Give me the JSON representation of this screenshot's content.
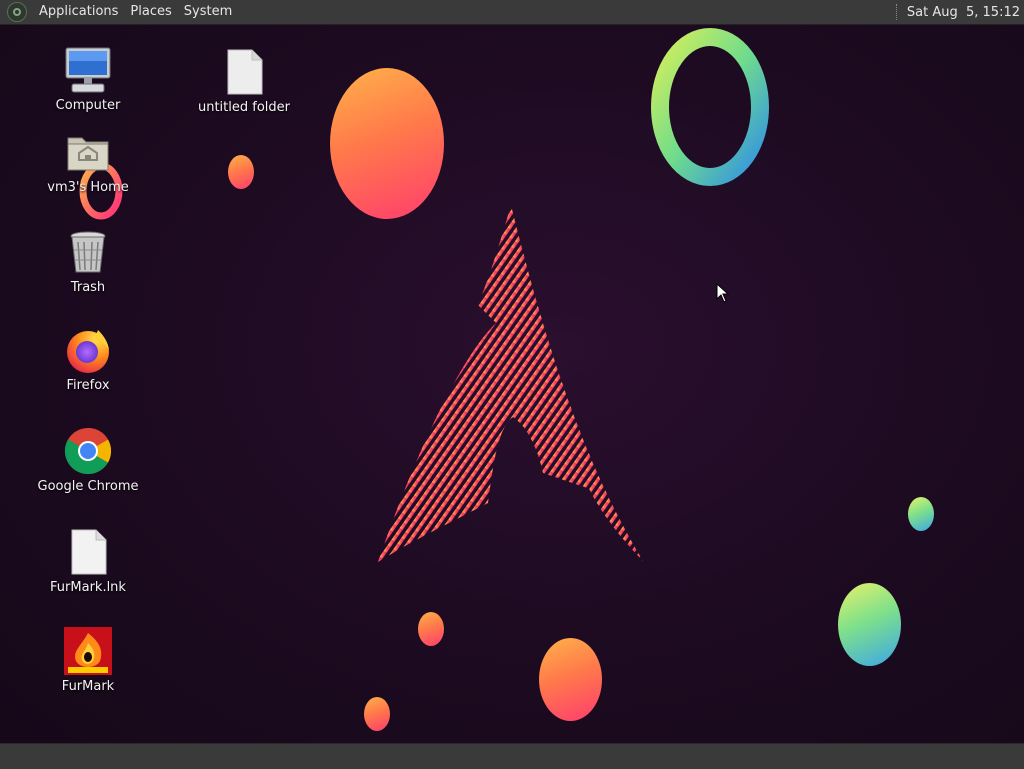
{
  "top_panel": {
    "menus": [
      "Applications",
      "Places",
      "System"
    ],
    "clock": "Sat Aug  5, 15:12"
  },
  "desktop": {
    "icons": [
      {
        "label": "Computer",
        "icon": "computer-icon"
      },
      {
        "label": "vm3's Home",
        "icon": "home-folder-icon"
      },
      {
        "label": "Trash",
        "icon": "trash-icon"
      },
      {
        "label": "Firefox",
        "icon": "firefox-icon"
      },
      {
        "label": "Google Chrome",
        "icon": "chrome-icon"
      },
      {
        "label": "FurMark.lnk",
        "icon": "file-icon"
      },
      {
        "label": "FurMark",
        "icon": "furmark-icon"
      },
      {
        "label": "untitled folder",
        "icon": "document-icon"
      }
    ]
  },
  "colors": {
    "panel": "#3a3a3a",
    "background": "#1e0b22",
    "arch_logo_start": "#f5d03a",
    "arch_logo_end": "#e8196e"
  }
}
